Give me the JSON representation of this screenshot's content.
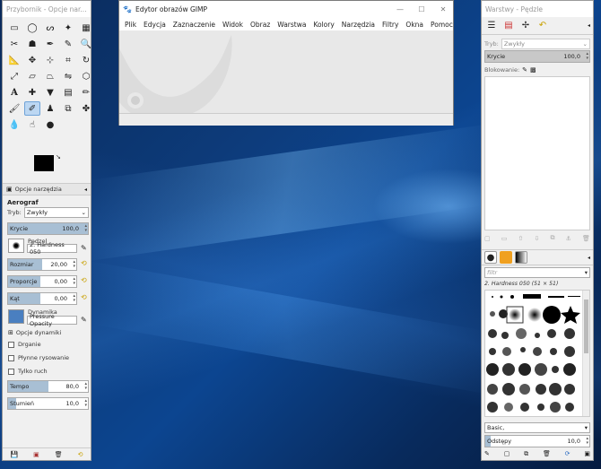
{
  "toolbox": {
    "title": "Przybornik - Opcje nar...",
    "tab_label": "Opcje narzędzia",
    "tool_name": "Aerograf",
    "mode_label": "Tryb:",
    "mode_value": "Zwykły",
    "opacity_label": "Krycie",
    "opacity_value": "100,0",
    "opacity_fraction": 1.0,
    "brush_label": "Pędzel",
    "brush_value": "2. Hardness 050",
    "size_label": "Rozmiar",
    "size_value": "20,00",
    "aspect_label": "Proporcje",
    "aspect_value": "0,00",
    "angle_label": "Kąt",
    "angle_value": "0,00",
    "dynamics_label": "Dynamika",
    "dynamics_value": "Pressure Opacity",
    "dynamics_options_label": "Opcje dynamiki",
    "jitter_label": "Drganie",
    "smooth_label": "Płynne rysowanie",
    "incremental_label": "Tylko ruch",
    "rate_label": "Tempo",
    "rate_value": "80,0",
    "rate_fraction": 0.5,
    "flow_label": "Stumień",
    "flow_value": "10,0",
    "flow_fraction": 0.1
  },
  "gimp": {
    "title": "Edytor obrazów GIMP",
    "menu": [
      "Plik",
      "Edycja",
      "Zaznaczenie",
      "Widok",
      "Obraz",
      "Warstwa",
      "Kolory",
      "Narzędzia",
      "Filtry",
      "Okna",
      "Pomoc"
    ]
  },
  "layers": {
    "title": "Warstwy - Pędzle",
    "mode_label": "Tryb:",
    "mode_value": "Zwykły",
    "opacity_label": "Krycie",
    "opacity_value": "100,0",
    "lock_label": "Blokowanie:",
    "filter_placeholder": "filtr",
    "brush_name": "2. Hardness 050 (51 × 51)",
    "preset_label": "Basic,",
    "spacing_label": "Odstępy",
    "spacing_value": "10,0"
  }
}
